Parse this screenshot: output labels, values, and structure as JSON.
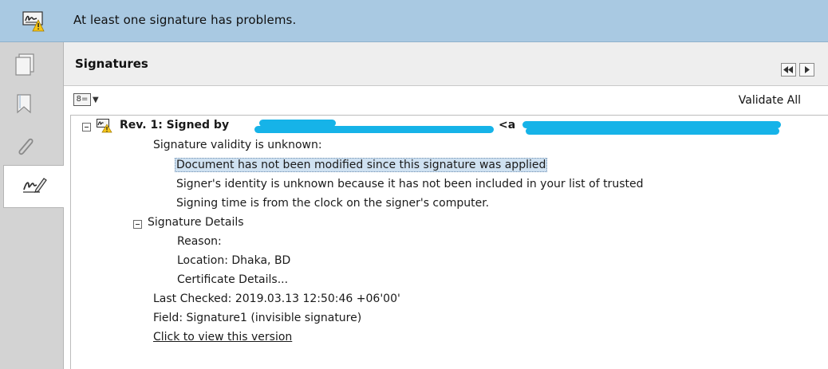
{
  "notification": {
    "icon": "signature-warning-icon",
    "message": "At least one signature has problems."
  },
  "rail": {
    "items": [
      {
        "name": "pages-icon",
        "active": false
      },
      {
        "name": "bookmarks-icon",
        "active": false
      },
      {
        "name": "attachments-icon",
        "active": false
      },
      {
        "name": "signatures-icon",
        "active": true
      }
    ]
  },
  "panel": {
    "title": "Signatures",
    "validate_all": "Validate All"
  },
  "signature": {
    "header_prefix": "Rev. 1: Signed by",
    "header_suffix": "<a",
    "validity": "Signature validity is unknown:",
    "details": [
      "Document has not been modified since this signature was applied",
      "Signer's identity is unknown because it has not been included in your list of trusted",
      "Signing time is from the clock on the signer's computer."
    ],
    "signature_details_label": "Signature Details",
    "reason": "Reason:",
    "location": "Location: Dhaka, BD",
    "certificate_details": "Certificate Details...",
    "last_checked": "Last Checked: 2019.03.13 12:50:46 +06'00'",
    "field": "Field: Signature1 (invisible signature)",
    "view_version": "Click to view this version"
  },
  "colors": {
    "notification_bg": "#a9c9e2",
    "rail_bg": "#d3d3d3",
    "redaction": "#16b3e8",
    "selection": "#cfe1f1"
  }
}
